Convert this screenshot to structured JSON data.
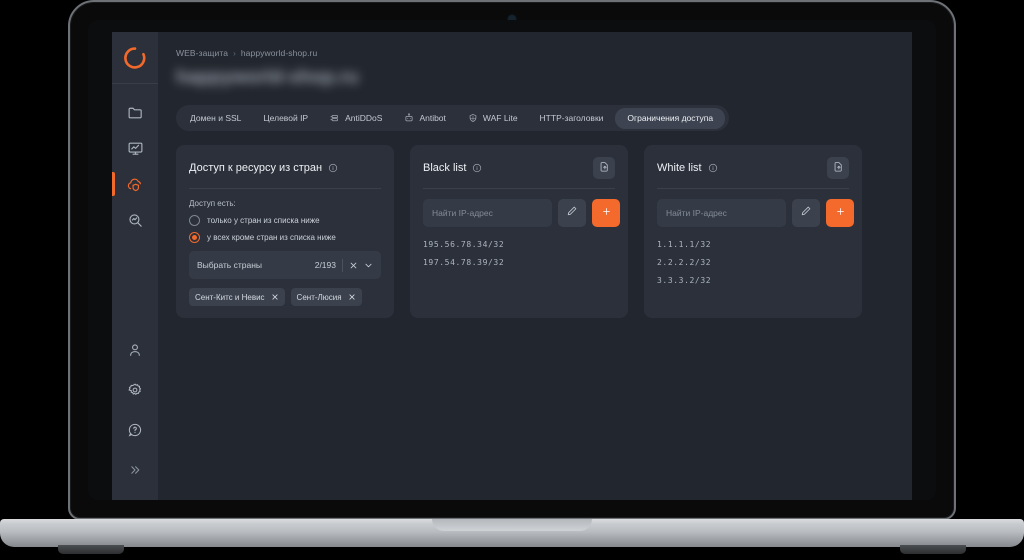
{
  "brand": {
    "logo_icon": "orange-ring-logo"
  },
  "sidebar": {
    "top_items": [
      {
        "icon": "folder-icon",
        "name": "projects",
        "active": false
      },
      {
        "icon": "monitor-chart-icon",
        "name": "analytics",
        "active": false
      },
      {
        "icon": "cloud-shield-icon",
        "name": "web-protection",
        "active": true
      },
      {
        "icon": "search-analytics-icon",
        "name": "logs",
        "active": false
      }
    ],
    "bottom_items": [
      {
        "icon": "user-icon",
        "name": "account"
      },
      {
        "icon": "gear-icon",
        "name": "settings"
      },
      {
        "icon": "question-circle-icon",
        "name": "help"
      },
      {
        "icon": "double-chevron-right-icon",
        "name": "expand-sidebar"
      }
    ]
  },
  "breadcrumb": {
    "root": "WEB-защита",
    "separator": "›",
    "current": "happyworld-shop.ru"
  },
  "page_title": "happyworld-shop.ru",
  "tabs": [
    {
      "label": "Домен и SSL",
      "icon": null,
      "active": false
    },
    {
      "label": "Целевой IP",
      "icon": null,
      "active": false
    },
    {
      "label": "AntiDDoS",
      "icon": "antiddos-icon",
      "active": false
    },
    {
      "label": "Antibot",
      "icon": "antibot-icon",
      "active": false
    },
    {
      "label": "WAF Lite",
      "icon": "waf-icon",
      "active": false
    },
    {
      "label": "HTTP-заголовки",
      "icon": null,
      "active": false
    },
    {
      "label": "Ограничения доступа",
      "icon": null,
      "active": true
    }
  ],
  "countries_card": {
    "title": "Доступ к ресурсу из стран",
    "info_icon": "info-circle-icon",
    "access_label": "Доступ есть:",
    "options": [
      {
        "label": "только у стран из списка ниже",
        "selected": false
      },
      {
        "label": "у всех кроме стран из списка ниже",
        "selected": true
      }
    ],
    "select": {
      "placeholder": "Выбрать страны",
      "count": "2/193",
      "clear_icon": "close-x-icon",
      "chevron_icon": "chevron-down-icon"
    },
    "chips": [
      {
        "label": "Сент-Китс и Невис",
        "remove_icon": "close-x-icon"
      },
      {
        "label": "Сент-Люсия",
        "remove_icon": "close-x-icon"
      }
    ]
  },
  "black_list": {
    "title": "Black list",
    "info_icon": "info-circle-icon",
    "export_icon": "file-export-icon",
    "search_placeholder": "Найти IP-адрес",
    "search_value": "",
    "edit_icon": "pencil-icon",
    "add_icon": "plus-icon",
    "items": [
      "195.56.78.34/32",
      "197.54.78.39/32"
    ]
  },
  "white_list": {
    "title": "White list",
    "info_icon": "info-circle-icon",
    "export_icon": "file-export-icon",
    "search_placeholder": "Найти IP-адрес",
    "search_value": "",
    "edit_icon": "pencil-icon",
    "add_icon": "plus-icon",
    "items": [
      "1.1.1.1/32",
      "2.2.2.2/32",
      "3.3.3.2/32"
    ]
  },
  "colors": {
    "accent_orange": "#f4692c",
    "app_bg": "#22262e",
    "card_bg": "#2b303a",
    "sidebar_bg": "#2b303a",
    "input_bg": "#353b46",
    "text_primary": "#eef1f5",
    "text_muted": "#8b929d"
  }
}
